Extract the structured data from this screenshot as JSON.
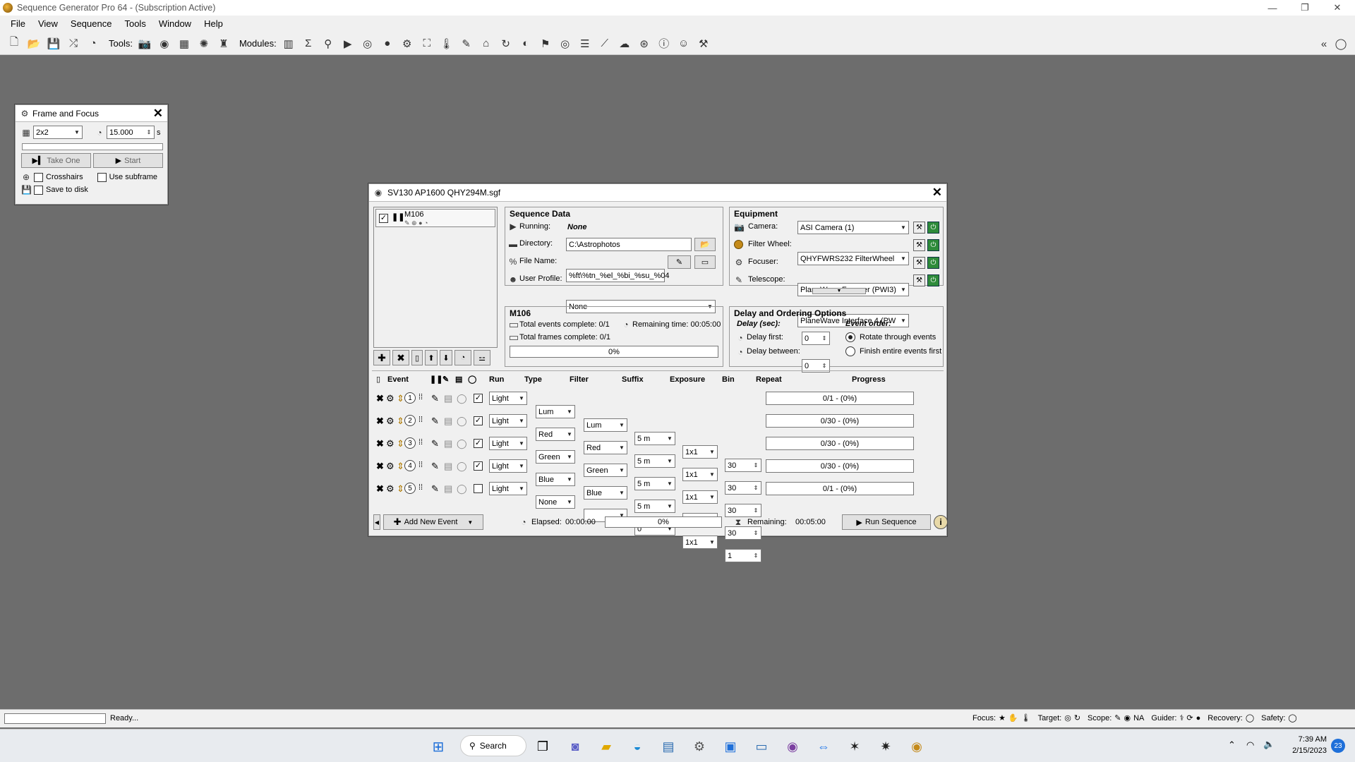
{
  "window": {
    "title": "Sequence Generator Pro 64 - (Subscription Active)",
    "min": "—",
    "max": "❐",
    "close": "✕"
  },
  "menu": [
    "File",
    "View",
    "Sequence",
    "Tools",
    "Window",
    "Help"
  ],
  "toolbar": {
    "tools_label": "Tools:",
    "modules_label": "Modules:",
    "collapse": "«"
  },
  "frame_focus": {
    "title": "Frame and Focus",
    "binning": "2x2",
    "exposure": "15.000",
    "unit": "s",
    "take_one": "Take One",
    "start": "Start",
    "crosshairs": "Crosshairs",
    "use_subframe": "Use subframe",
    "save_to_disk": "Save to disk"
  },
  "seq": {
    "title": "SV130 AP1600 QHY294M.sgf",
    "target": "M106",
    "seqdata": {
      "header": "Sequence Data",
      "running_label": "Running:",
      "running": "None",
      "directory_label": "Directory:",
      "directory": "C:\\Astrophotos",
      "filename_label": "File Name:",
      "filename": "%ft\\%tn_%el_%bi_%su_%04",
      "profile_label": "User Profile:",
      "profile": "None"
    },
    "equipment": {
      "header": "Equipment",
      "camera_label": "Camera:",
      "camera": "ASI Camera (1)",
      "filter_label": "Filter Wheel:",
      "filter": "QHYFWRS232 FilterWheel",
      "focuser_label": "Focuser:",
      "focuser": "PlaneWave Focuser (PWI3)",
      "telescope_label": "Telescope:",
      "telescope": "PlaneWave Interface 4 (PW"
    },
    "target_info": {
      "name": "M106",
      "events": "Total events complete: 0/1",
      "remaining": "Remaining time: 00:05:00",
      "frames": "Total frames complete: 0/1",
      "progress": "0%"
    },
    "delay": {
      "header": "Delay and Ordering Options",
      "sub": "Delay (sec):",
      "first_label": "Delay first:",
      "first": "0",
      "between_label": "Delay between:",
      "between": "0",
      "order": "Event order:",
      "rotate": "Rotate through events",
      "finish": "Finish entire events first"
    },
    "columns": {
      "event": "Event",
      "run": "Run",
      "type": "Type",
      "filter": "Filter",
      "suffix": "Suffix",
      "exposure": "Exposure",
      "bin": "Bin",
      "repeat": "Repeat",
      "progress": "Progress"
    },
    "events": [
      {
        "n": "1",
        "run": "✓",
        "type": "Light",
        "filter": "Lum",
        "suffix": "Lum",
        "exposure": "5 m",
        "bin": "1x1",
        "repeat": "30",
        "progress": "0/1 - (0%)"
      },
      {
        "n": "2",
        "run": "✓",
        "type": "Light",
        "filter": "Red",
        "suffix": "Red",
        "exposure": "5 m",
        "bin": "1x1",
        "repeat": "30",
        "progress": "0/30 - (0%)"
      },
      {
        "n": "3",
        "run": "✓",
        "type": "Light",
        "filter": "Green",
        "suffix": "Green",
        "exposure": "5 m",
        "bin": "1x1",
        "repeat": "30",
        "progress": "0/30 - (0%)"
      },
      {
        "n": "4",
        "run": "✓",
        "type": "Light",
        "filter": "Blue",
        "suffix": "Blue",
        "exposure": "5 m",
        "bin": "1x1",
        "repeat": "30",
        "progress": "0/30 - (0%)"
      },
      {
        "n": "5",
        "run": "",
        "type": "Light",
        "filter": "None",
        "suffix": "",
        "exposure": "0",
        "bin": "1x1",
        "repeat": "1",
        "progress": "0/1 - (0%)"
      }
    ],
    "footer": {
      "add": "Add New Event",
      "elapsed_label": "Elapsed:",
      "elapsed": "00:00:00",
      "progress": "0%",
      "remaining_label": "Remaining:",
      "remaining": "00:05:00",
      "run": "Run Sequence"
    }
  },
  "status": {
    "text": "Ready...",
    "focus": "Focus:",
    "target": "Target:",
    "scope": "Scope:",
    "scope_val": "NA",
    "guider": "Guider:",
    "recovery": "Recovery:",
    "safety": "Safety:"
  },
  "taskbar": {
    "search": "Search",
    "time": "7:39 AM",
    "date": "2/15/2023",
    "badge": "23"
  }
}
